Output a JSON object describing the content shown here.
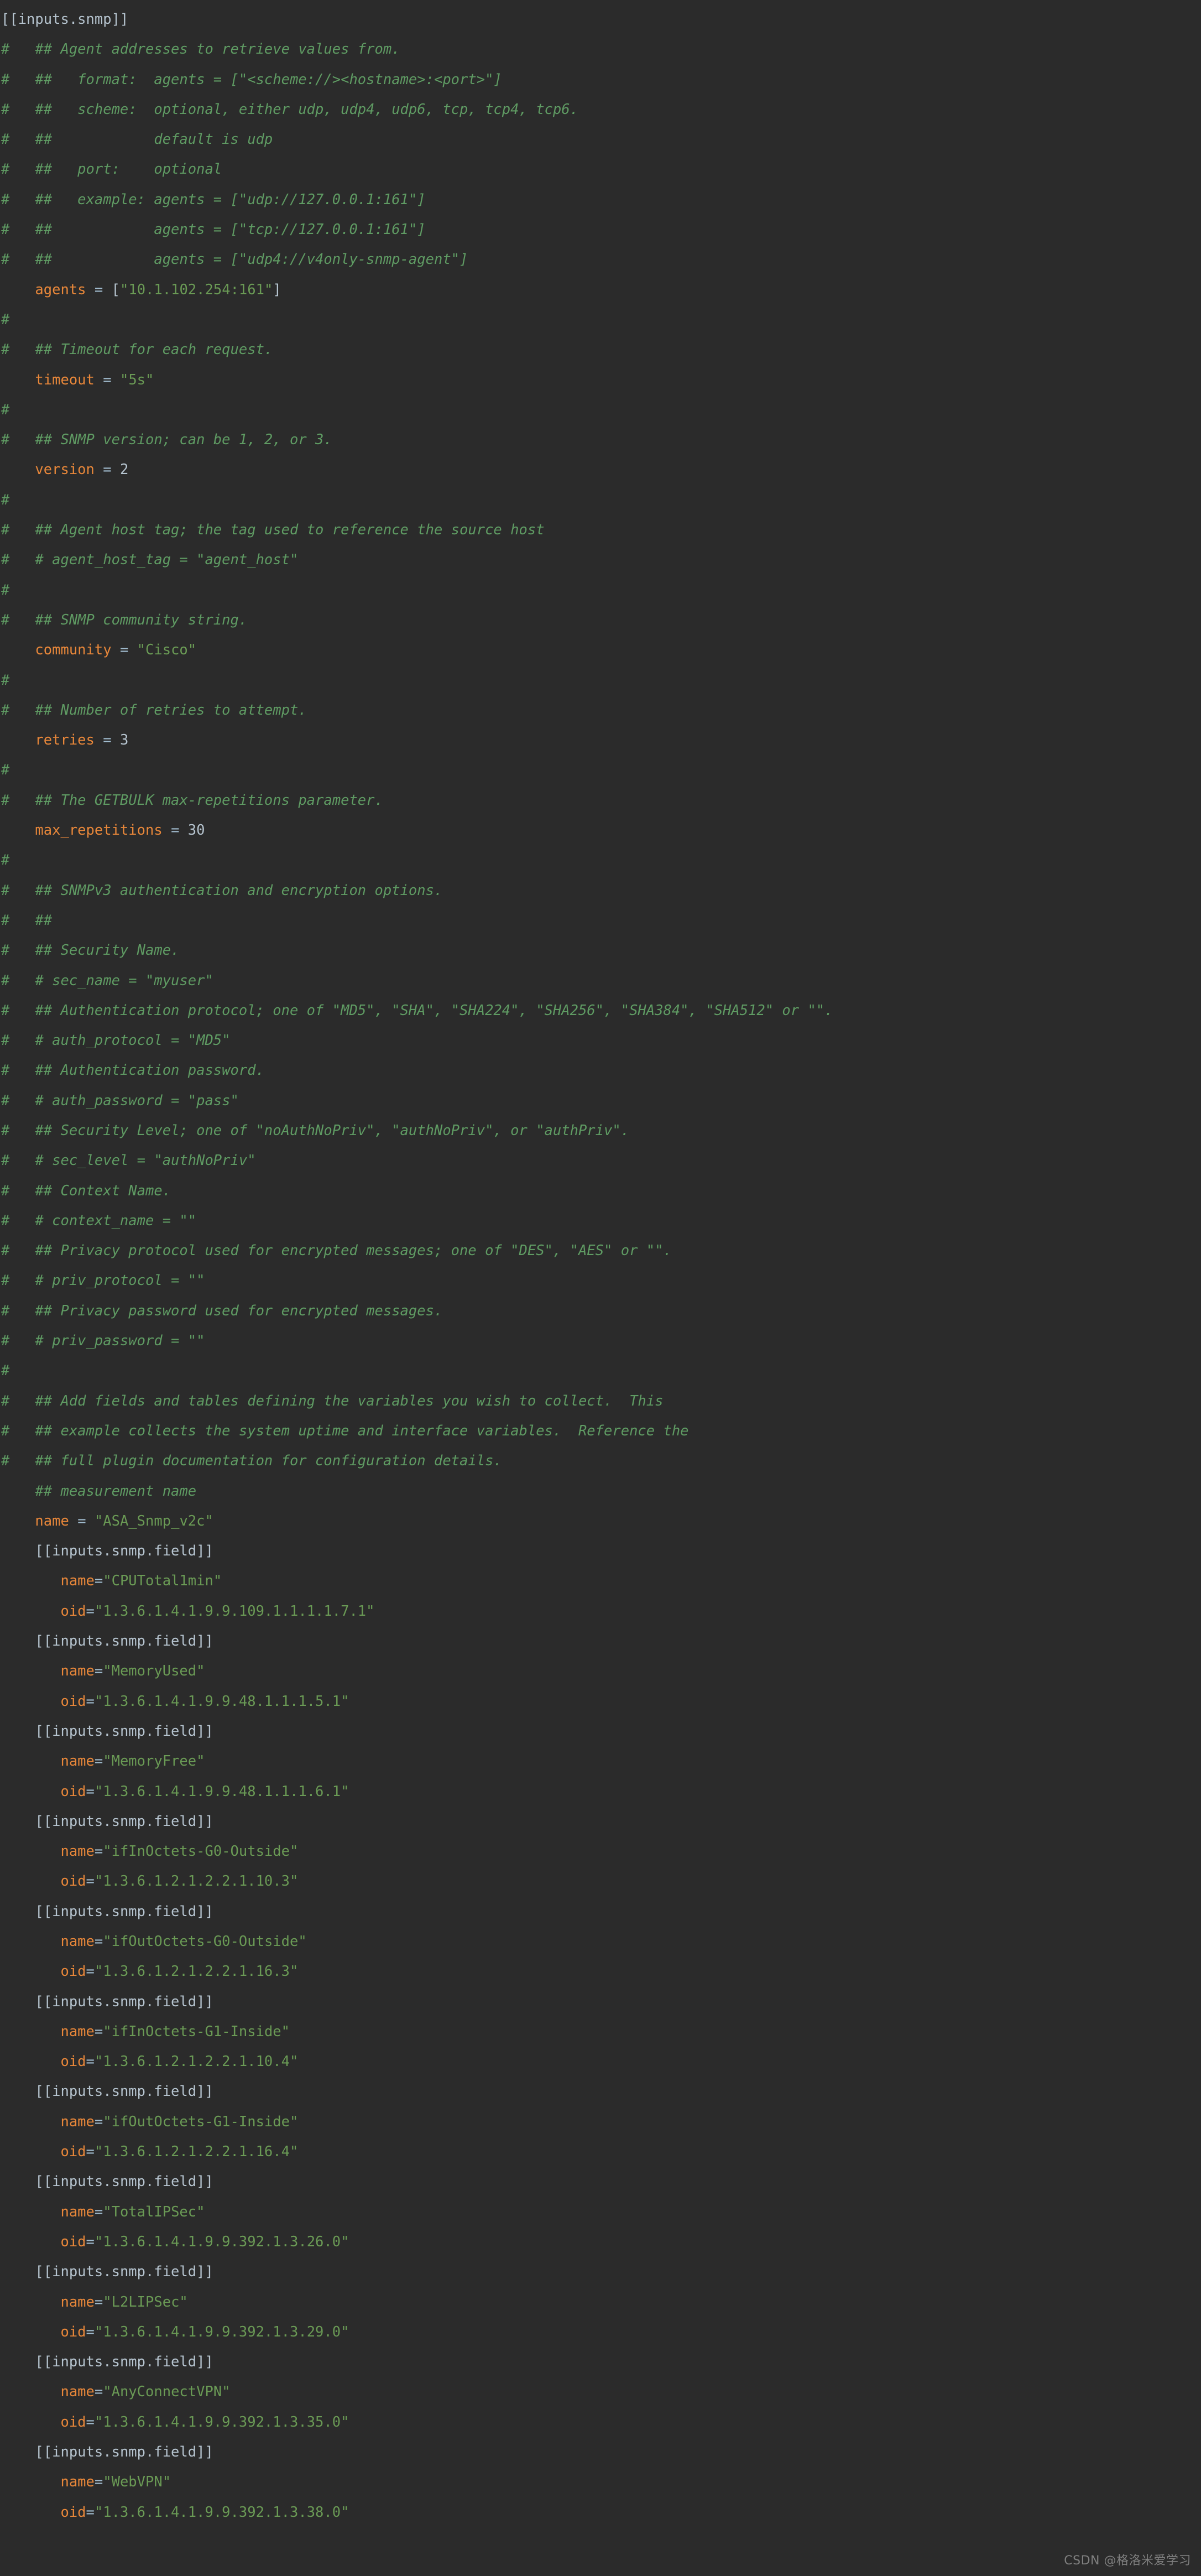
{
  "editor": {
    "background_color": "#2b2b2b",
    "colors": {
      "comment": "#5f9b63",
      "key": "#e8873a",
      "string": "#6a9a55",
      "punctuation": "#b6c4cf",
      "equals": "#a2bdd0",
      "number": "#b6c4cf"
    },
    "file_type": "toml",
    "lines": [
      [
        {
          "t": "table",
          "v": "[[inputs.snmp]]"
        }
      ],
      [
        {
          "t": "comment",
          "v": "#   ## Agent addresses to retrieve values from."
        }
      ],
      [
        {
          "t": "comment",
          "v": "#   ##   format:  agents = [\"<scheme://><hostname>:<port>\"]"
        }
      ],
      [
        {
          "t": "comment",
          "v": "#   ##   scheme:  optional, either udp, udp4, udp6, tcp, tcp4, tcp6."
        }
      ],
      [
        {
          "t": "comment",
          "v": "#   ##            default is udp"
        }
      ],
      [
        {
          "t": "comment",
          "v": "#   ##   port:    optional"
        }
      ],
      [
        {
          "t": "comment",
          "v": "#   ##   example: agents = [\"udp://127.0.0.1:161\"]"
        }
      ],
      [
        {
          "t": "comment",
          "v": "#   ##            agents = [\"tcp://127.0.0.1:161\"]"
        }
      ],
      [
        {
          "t": "comment",
          "v": "#   ##            agents = [\"udp4://v4only-snmp-agent\"]"
        }
      ],
      [
        {
          "t": "plain",
          "v": "    "
        },
        {
          "t": "key",
          "v": "agents"
        },
        {
          "t": "plain",
          "v": " "
        },
        {
          "t": "eq",
          "v": "="
        },
        {
          "t": "plain",
          "v": " "
        },
        {
          "t": "punct",
          "v": "["
        },
        {
          "t": "string",
          "v": "\"10.1.102.254:161\""
        },
        {
          "t": "punct",
          "v": "]"
        }
      ],
      [
        {
          "t": "comment",
          "v": "#"
        }
      ],
      [
        {
          "t": "comment",
          "v": "#   ## Timeout for each request."
        }
      ],
      [
        {
          "t": "plain",
          "v": "    "
        },
        {
          "t": "key",
          "v": "timeout"
        },
        {
          "t": "plain",
          "v": " "
        },
        {
          "t": "eq",
          "v": "="
        },
        {
          "t": "plain",
          "v": " "
        },
        {
          "t": "string",
          "v": "\"5s\""
        }
      ],
      [
        {
          "t": "comment",
          "v": "#"
        }
      ],
      [
        {
          "t": "comment",
          "v": "#   ## SNMP version; can be 1, 2, or 3."
        }
      ],
      [
        {
          "t": "plain",
          "v": "    "
        },
        {
          "t": "key",
          "v": "version"
        },
        {
          "t": "plain",
          "v": " "
        },
        {
          "t": "eq",
          "v": "="
        },
        {
          "t": "plain",
          "v": " "
        },
        {
          "t": "num",
          "v": "2"
        }
      ],
      [
        {
          "t": "comment",
          "v": "#"
        }
      ],
      [
        {
          "t": "comment",
          "v": "#   ## Agent host tag; the tag used to reference the source host"
        }
      ],
      [
        {
          "t": "comment",
          "v": "#   # agent_host_tag = \"agent_host\""
        }
      ],
      [
        {
          "t": "comment",
          "v": "#"
        }
      ],
      [
        {
          "t": "comment",
          "v": "#   ## SNMP community string."
        }
      ],
      [
        {
          "t": "plain",
          "v": "    "
        },
        {
          "t": "key",
          "v": "community"
        },
        {
          "t": "plain",
          "v": " "
        },
        {
          "t": "eq",
          "v": "="
        },
        {
          "t": "plain",
          "v": " "
        },
        {
          "t": "string",
          "v": "\"Cisco\""
        }
      ],
      [
        {
          "t": "comment",
          "v": "#"
        }
      ],
      [
        {
          "t": "comment",
          "v": "#   ## Number of retries to attempt."
        }
      ],
      [
        {
          "t": "plain",
          "v": "    "
        },
        {
          "t": "key",
          "v": "retries"
        },
        {
          "t": "plain",
          "v": " "
        },
        {
          "t": "eq",
          "v": "="
        },
        {
          "t": "plain",
          "v": " "
        },
        {
          "t": "num",
          "v": "3"
        }
      ],
      [
        {
          "t": "comment",
          "v": "#"
        }
      ],
      [
        {
          "t": "comment",
          "v": "#   ## The GETBULK max-repetitions parameter."
        }
      ],
      [
        {
          "t": "plain",
          "v": "    "
        },
        {
          "t": "key",
          "v": "max_repetitions"
        },
        {
          "t": "plain",
          "v": " "
        },
        {
          "t": "eq",
          "v": "="
        },
        {
          "t": "plain",
          "v": " "
        },
        {
          "t": "num",
          "v": "30"
        }
      ],
      [
        {
          "t": "comment",
          "v": "#"
        }
      ],
      [
        {
          "t": "comment",
          "v": "#   ## SNMPv3 authentication and encryption options."
        }
      ],
      [
        {
          "t": "comment",
          "v": "#   ##"
        }
      ],
      [
        {
          "t": "comment",
          "v": "#   ## Security Name."
        }
      ],
      [
        {
          "t": "comment",
          "v": "#   # sec_name = \"myuser\""
        }
      ],
      [
        {
          "t": "comment",
          "v": "#   ## Authentication protocol; one of \"MD5\", \"SHA\", \"SHA224\", \"SHA256\", \"SHA384\", \"SHA512\" or \"\"."
        }
      ],
      [
        {
          "t": "comment",
          "v": "#   # auth_protocol = \"MD5\""
        }
      ],
      [
        {
          "t": "comment",
          "v": "#   ## Authentication password."
        }
      ],
      [
        {
          "t": "comment",
          "v": "#   # auth_password = \"pass\""
        }
      ],
      [
        {
          "t": "comment",
          "v": "#   ## Security Level; one of \"noAuthNoPriv\", \"authNoPriv\", or \"authPriv\"."
        }
      ],
      [
        {
          "t": "comment",
          "v": "#   # sec_level = \"authNoPriv\""
        }
      ],
      [
        {
          "t": "comment",
          "v": "#   ## Context Name."
        }
      ],
      [
        {
          "t": "comment",
          "v": "#   # context_name = \"\""
        }
      ],
      [
        {
          "t": "comment",
          "v": "#   ## Privacy protocol used for encrypted messages; one of \"DES\", \"AES\" or \"\"."
        }
      ],
      [
        {
          "t": "comment",
          "v": "#   # priv_protocol = \"\""
        }
      ],
      [
        {
          "t": "comment",
          "v": "#   ## Privacy password used for encrypted messages."
        }
      ],
      [
        {
          "t": "comment",
          "v": "#   # priv_password = \"\""
        }
      ],
      [
        {
          "t": "comment",
          "v": "#"
        }
      ],
      [
        {
          "t": "comment",
          "v": "#   ## Add fields and tables defining the variables you wish to collect.  This"
        }
      ],
      [
        {
          "t": "comment",
          "v": "#   ## example collects the system uptime and interface variables.  Reference the"
        }
      ],
      [
        {
          "t": "comment",
          "v": "#   ## full plugin documentation for configuration details."
        }
      ],
      [
        {
          "t": "plain",
          "v": "    "
        },
        {
          "t": "comment",
          "v": "## measurement name"
        }
      ],
      [
        {
          "t": "plain",
          "v": "    "
        },
        {
          "t": "key",
          "v": "name"
        },
        {
          "t": "plain",
          "v": " "
        },
        {
          "t": "eq",
          "v": "="
        },
        {
          "t": "plain",
          "v": " "
        },
        {
          "t": "string",
          "v": "\"ASA_Snmp_v2c\""
        }
      ],
      [
        {
          "t": "plain",
          "v": "    "
        },
        {
          "t": "table",
          "v": "[[inputs.snmp.field]]"
        }
      ],
      [
        {
          "t": "plain",
          "v": "       "
        },
        {
          "t": "key",
          "v": "name"
        },
        {
          "t": "eq",
          "v": "="
        },
        {
          "t": "string",
          "v": "\"CPUTotal1min\""
        }
      ],
      [
        {
          "t": "plain",
          "v": "       "
        },
        {
          "t": "key",
          "v": "oid"
        },
        {
          "t": "eq",
          "v": "="
        },
        {
          "t": "string",
          "v": "\"1.3.6.1.4.1.9.9.109.1.1.1.1.7.1\""
        }
      ],
      [
        {
          "t": "plain",
          "v": "    "
        },
        {
          "t": "table",
          "v": "[[inputs.snmp.field]]"
        }
      ],
      [
        {
          "t": "plain",
          "v": "       "
        },
        {
          "t": "key",
          "v": "name"
        },
        {
          "t": "eq",
          "v": "="
        },
        {
          "t": "string",
          "v": "\"MemoryUsed\""
        }
      ],
      [
        {
          "t": "plain",
          "v": "       "
        },
        {
          "t": "key",
          "v": "oid"
        },
        {
          "t": "eq",
          "v": "="
        },
        {
          "t": "string",
          "v": "\"1.3.6.1.4.1.9.9.48.1.1.1.5.1\""
        }
      ],
      [
        {
          "t": "plain",
          "v": "    "
        },
        {
          "t": "table",
          "v": "[[inputs.snmp.field]]"
        }
      ],
      [
        {
          "t": "plain",
          "v": "       "
        },
        {
          "t": "key",
          "v": "name"
        },
        {
          "t": "eq",
          "v": "="
        },
        {
          "t": "string",
          "v": "\"MemoryFree\""
        }
      ],
      [
        {
          "t": "plain",
          "v": "       "
        },
        {
          "t": "key",
          "v": "oid"
        },
        {
          "t": "eq",
          "v": "="
        },
        {
          "t": "string",
          "v": "\"1.3.6.1.4.1.9.9.48.1.1.1.6.1\""
        }
      ],
      [
        {
          "t": "plain",
          "v": "    "
        },
        {
          "t": "table",
          "v": "[[inputs.snmp.field]]"
        }
      ],
      [
        {
          "t": "plain",
          "v": "       "
        },
        {
          "t": "key",
          "v": "name"
        },
        {
          "t": "eq",
          "v": "="
        },
        {
          "t": "string",
          "v": "\"ifInOctets-G0-Outside\""
        }
      ],
      [
        {
          "t": "plain",
          "v": "       "
        },
        {
          "t": "key",
          "v": "oid"
        },
        {
          "t": "eq",
          "v": "="
        },
        {
          "t": "string",
          "v": "\"1.3.6.1.2.1.2.2.1.10.3\""
        }
      ],
      [
        {
          "t": "plain",
          "v": "    "
        },
        {
          "t": "table",
          "v": "[[inputs.snmp.field]]"
        }
      ],
      [
        {
          "t": "plain",
          "v": "       "
        },
        {
          "t": "key",
          "v": "name"
        },
        {
          "t": "eq",
          "v": "="
        },
        {
          "t": "string",
          "v": "\"ifOutOctets-G0-Outside\""
        }
      ],
      [
        {
          "t": "plain",
          "v": "       "
        },
        {
          "t": "key",
          "v": "oid"
        },
        {
          "t": "eq",
          "v": "="
        },
        {
          "t": "string",
          "v": "\"1.3.6.1.2.1.2.2.1.16.3\""
        }
      ],
      [
        {
          "t": "plain",
          "v": "    "
        },
        {
          "t": "table",
          "v": "[[inputs.snmp.field]]"
        }
      ],
      [
        {
          "t": "plain",
          "v": "       "
        },
        {
          "t": "key",
          "v": "name"
        },
        {
          "t": "eq",
          "v": "="
        },
        {
          "t": "string",
          "v": "\"ifInOctets-G1-Inside\""
        }
      ],
      [
        {
          "t": "plain",
          "v": "       "
        },
        {
          "t": "key",
          "v": "oid"
        },
        {
          "t": "eq",
          "v": "="
        },
        {
          "t": "string",
          "v": "\"1.3.6.1.2.1.2.2.1.10.4\""
        }
      ],
      [
        {
          "t": "plain",
          "v": "    "
        },
        {
          "t": "table",
          "v": "[[inputs.snmp.field]]"
        }
      ],
      [
        {
          "t": "plain",
          "v": "       "
        },
        {
          "t": "key",
          "v": "name"
        },
        {
          "t": "eq",
          "v": "="
        },
        {
          "t": "string",
          "v": "\"ifOutOctets-G1-Inside\""
        }
      ],
      [
        {
          "t": "plain",
          "v": "       "
        },
        {
          "t": "key",
          "v": "oid"
        },
        {
          "t": "eq",
          "v": "="
        },
        {
          "t": "string",
          "v": "\"1.3.6.1.2.1.2.2.1.16.4\""
        }
      ],
      [
        {
          "t": "plain",
          "v": "    "
        },
        {
          "t": "table",
          "v": "[[inputs.snmp.field]]"
        }
      ],
      [
        {
          "t": "plain",
          "v": "       "
        },
        {
          "t": "key",
          "v": "name"
        },
        {
          "t": "eq",
          "v": "="
        },
        {
          "t": "string",
          "v": "\"TotalIPSec\""
        }
      ],
      [
        {
          "t": "plain",
          "v": "       "
        },
        {
          "t": "key",
          "v": "oid"
        },
        {
          "t": "eq",
          "v": "="
        },
        {
          "t": "string",
          "v": "\"1.3.6.1.4.1.9.9.392.1.3.26.0\""
        }
      ],
      [
        {
          "t": "plain",
          "v": "    "
        },
        {
          "t": "table",
          "v": "[[inputs.snmp.field]]"
        }
      ],
      [
        {
          "t": "plain",
          "v": "       "
        },
        {
          "t": "key",
          "v": "name"
        },
        {
          "t": "eq",
          "v": "="
        },
        {
          "t": "string",
          "v": "\"L2LIPSec\""
        }
      ],
      [
        {
          "t": "plain",
          "v": "       "
        },
        {
          "t": "key",
          "v": "oid"
        },
        {
          "t": "eq",
          "v": "="
        },
        {
          "t": "string",
          "v": "\"1.3.6.1.4.1.9.9.392.1.3.29.0\""
        }
      ],
      [
        {
          "t": "plain",
          "v": "    "
        },
        {
          "t": "table",
          "v": "[[inputs.snmp.field]]"
        }
      ],
      [
        {
          "t": "plain",
          "v": "       "
        },
        {
          "t": "key",
          "v": "name"
        },
        {
          "t": "eq",
          "v": "="
        },
        {
          "t": "string",
          "v": "\"AnyConnectVPN\""
        }
      ],
      [
        {
          "t": "plain",
          "v": "       "
        },
        {
          "t": "key",
          "v": "oid"
        },
        {
          "t": "eq",
          "v": "="
        },
        {
          "t": "string",
          "v": "\"1.3.6.1.4.1.9.9.392.1.3.35.0\""
        }
      ],
      [
        {
          "t": "plain",
          "v": "    "
        },
        {
          "t": "table",
          "v": "[[inputs.snmp.field]]"
        }
      ],
      [
        {
          "t": "plain",
          "v": "       "
        },
        {
          "t": "key",
          "v": "name"
        },
        {
          "t": "eq",
          "v": "="
        },
        {
          "t": "string",
          "v": "\"WebVPN\""
        }
      ],
      [
        {
          "t": "plain",
          "v": "       "
        },
        {
          "t": "key",
          "v": "oid"
        },
        {
          "t": "eq",
          "v": "="
        },
        {
          "t": "string",
          "v": "\"1.3.6.1.4.1.9.9.392.1.3.38.0\""
        }
      ]
    ]
  },
  "watermark": {
    "text": "CSDN @格洛米爱学习"
  }
}
